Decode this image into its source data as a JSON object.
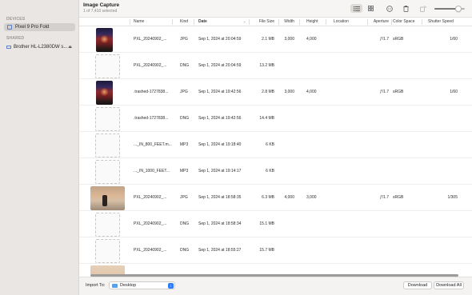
{
  "sidebar": {
    "devices_header": "DEVICES",
    "device": "Pixel 9 Pro Fold",
    "shared_header": "SHARED",
    "shared_device": "Brother HL-L2380DW s..."
  },
  "toolbar": {
    "title": "Image Capture",
    "subtitle": "1 of 7,410 selected",
    "list_view_icon": "list-icon",
    "grid_view_icon": "grid-icon",
    "zoom_level": 0.8
  },
  "table": {
    "columns": {
      "name": "Name",
      "kind": "Kind",
      "date": "Date",
      "file_size": "File Size",
      "width": "Width",
      "height": "Height",
      "location": "Location",
      "aperture": "Aperture",
      "color_space": "Color Space",
      "shutter_speed": "Shutter Speed"
    },
    "rows": [
      {
        "thumb": "portrait",
        "name": "PXL_20240902_...",
        "kind": "JPG",
        "date": "Sep 1, 2024 at 20:04:59",
        "size": "2.1 MB",
        "width": "3,000",
        "height": "4,000",
        "aperture": "ƒ/1.7",
        "color_space": "sRGB",
        "shutter": "1/60"
      },
      {
        "thumb": "empty",
        "name": "PXL_20240902_...",
        "kind": "DNG",
        "date": "Sep 1, 2024 at 20:04:59",
        "size": "13.2 MB",
        "width": "",
        "height": "",
        "aperture": "",
        "color_space": "",
        "shutter": ""
      },
      {
        "thumb": "portrait",
        "name": ".trashed-1727838...",
        "kind": "JPG",
        "date": "Sep 1, 2024 at 19:42:56",
        "size": "2.8 MB",
        "width": "3,000",
        "height": "4,000",
        "aperture": "ƒ/1.7",
        "color_space": "sRGB",
        "shutter": "1/60"
      },
      {
        "thumb": "empty",
        "name": ".trashed-1727838...",
        "kind": "DNG",
        "date": "Sep 1, 2024 at 19:42:56",
        "size": "14.4 MB",
        "width": "",
        "height": "",
        "aperture": "",
        "color_space": "",
        "shutter": ""
      },
      {
        "thumb": "empty",
        "name": "..._IN_800_FEET.m...",
        "kind": "MP3",
        "date": "Sep 1, 2024 at 19:18:40",
        "size": "6 KB",
        "width": "",
        "height": "",
        "aperture": "",
        "color_space": "",
        "shutter": ""
      },
      {
        "thumb": "empty",
        "name": "..._IN_1000_FEET...",
        "kind": "MP3",
        "date": "Sep 1, 2024 at 19:14:17",
        "size": "6 KB",
        "width": "",
        "height": "",
        "aperture": "",
        "color_space": "",
        "shutter": ""
      },
      {
        "thumb": "landscape",
        "name": "PXL_20240902_...",
        "kind": "JPG",
        "date": "Sep 1, 2024 at 18:58:35",
        "size": "6.3 MB",
        "width": "4,000",
        "height": "3,000",
        "aperture": "ƒ/1.7",
        "color_space": "sRGB",
        "shutter": "1/305"
      },
      {
        "thumb": "empty",
        "name": "PXL_20240902_...",
        "kind": "DNG",
        "date": "Sep 1, 2024 at 18:58:34",
        "size": "15.1 MB",
        "width": "",
        "height": "",
        "aperture": "",
        "color_space": "",
        "shutter": ""
      },
      {
        "thumb": "empty",
        "name": "PXL_20240902_...",
        "kind": "DNG",
        "date": "Sep 1, 2024 at 18:55:27",
        "size": "15.7 MB",
        "width": "",
        "height": "",
        "aperture": "",
        "color_space": "",
        "shutter": ""
      },
      {
        "thumb": "sunset",
        "name": "",
        "kind": "",
        "date": "",
        "size": "",
        "width": "",
        "height": "",
        "aperture": "",
        "color_space": "",
        "shutter": ""
      }
    ]
  },
  "footer": {
    "import_label": "Import To:",
    "import_destination": "Desktop",
    "download_label": "Download",
    "download_all_label": "Download All"
  }
}
